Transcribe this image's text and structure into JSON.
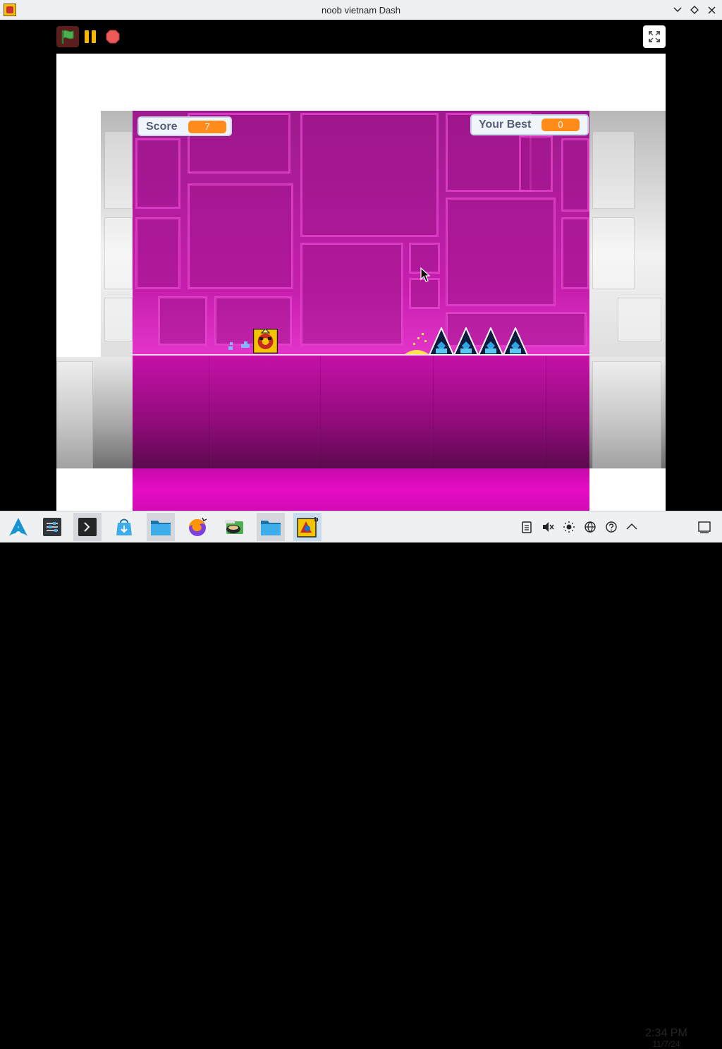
{
  "window": {
    "title": "noob vietnam Dash"
  },
  "toolbar": {
    "green_flag": "green-flag-icon",
    "pause": "pause-icon",
    "stop": "stop-icon",
    "fullscreen": "fullscreen-icon"
  },
  "game": {
    "score_label": "Score",
    "score_value": "7",
    "best_label": "Your Best",
    "best_value": "0",
    "spike_count": 4
  },
  "taskbar": {
    "launcher": "arch-linux-icon",
    "apps": [
      "system-settings-icon",
      "terminal-icon",
      "discover-icon",
      "file-manager-icon",
      "firefox-icon",
      "sandwich-app-icon",
      "folder-icon",
      "game-icon"
    ],
    "time": "2:34 PM",
    "date": "11/7/24"
  },
  "colors": {
    "magenta": "#c61fae",
    "score_badge": "#ff8c1a",
    "player_yellow": "#f5c400"
  }
}
